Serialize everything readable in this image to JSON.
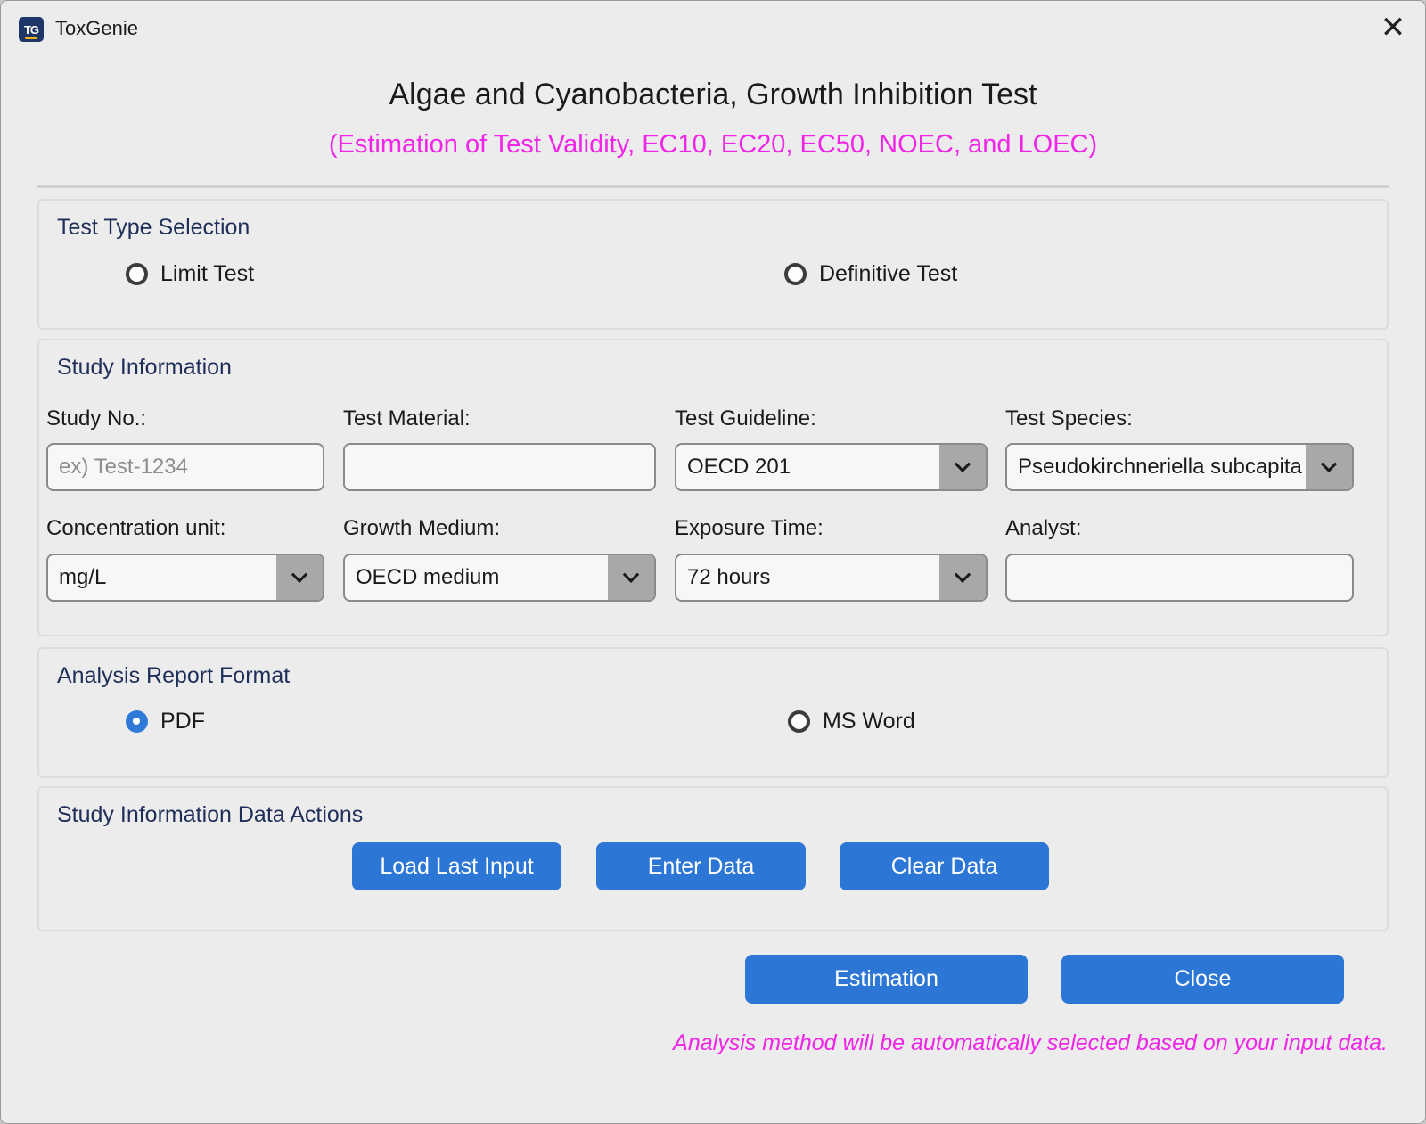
{
  "window": {
    "app_icon_text": "TG",
    "app_title": "ToxGenie",
    "close_glyph": "✕"
  },
  "header": {
    "title": "Algae and Cyanobacteria, Growth Inhibition Test",
    "subtitle": "(Estimation of Test Validity, EC10, EC20, EC50, NOEC, and LOEC)"
  },
  "test_type": {
    "title": "Test Type Selection",
    "options": [
      {
        "label": "Limit Test",
        "checked": false
      },
      {
        "label": "Definitive Test",
        "checked": false
      }
    ]
  },
  "study_info": {
    "title": "Study Information",
    "study_no": {
      "label": "Study No.:",
      "value": "",
      "placeholder": "ex) Test-1234"
    },
    "test_material": {
      "label": "Test Material:",
      "value": "",
      "placeholder": ""
    },
    "test_guideline": {
      "label": "Test Guideline:",
      "value": "OECD 201"
    },
    "test_species": {
      "label": "Test Species:",
      "value": "Pseudokirchneriella subcapitata"
    },
    "concentration_unit": {
      "label": "Concentration unit:",
      "value": "mg/L"
    },
    "growth_medium": {
      "label": "Growth Medium:",
      "value": "OECD medium"
    },
    "exposure_time": {
      "label": "Exposure Time:",
      "value": "72 hours"
    },
    "analyst": {
      "label": "Analyst:",
      "value": "",
      "placeholder": ""
    }
  },
  "report_format": {
    "title": "Analysis Report Format",
    "options": [
      {
        "label": "PDF",
        "checked": true
      },
      {
        "label": "MS Word",
        "checked": false
      }
    ]
  },
  "data_actions": {
    "title": "Study Information Data Actions",
    "load_last_input": "Load Last Input",
    "enter_data": "Enter Data",
    "clear_data": "Clear Data"
  },
  "footer": {
    "estimation": "Estimation",
    "close": "Close",
    "note": "Analysis method will be automatically selected based on your input data."
  },
  "colors": {
    "accent": "#2c76d6",
    "highlight": "#f025e8",
    "radio_checked": "#2f7ad8",
    "group_title": "#1f2f5a"
  }
}
